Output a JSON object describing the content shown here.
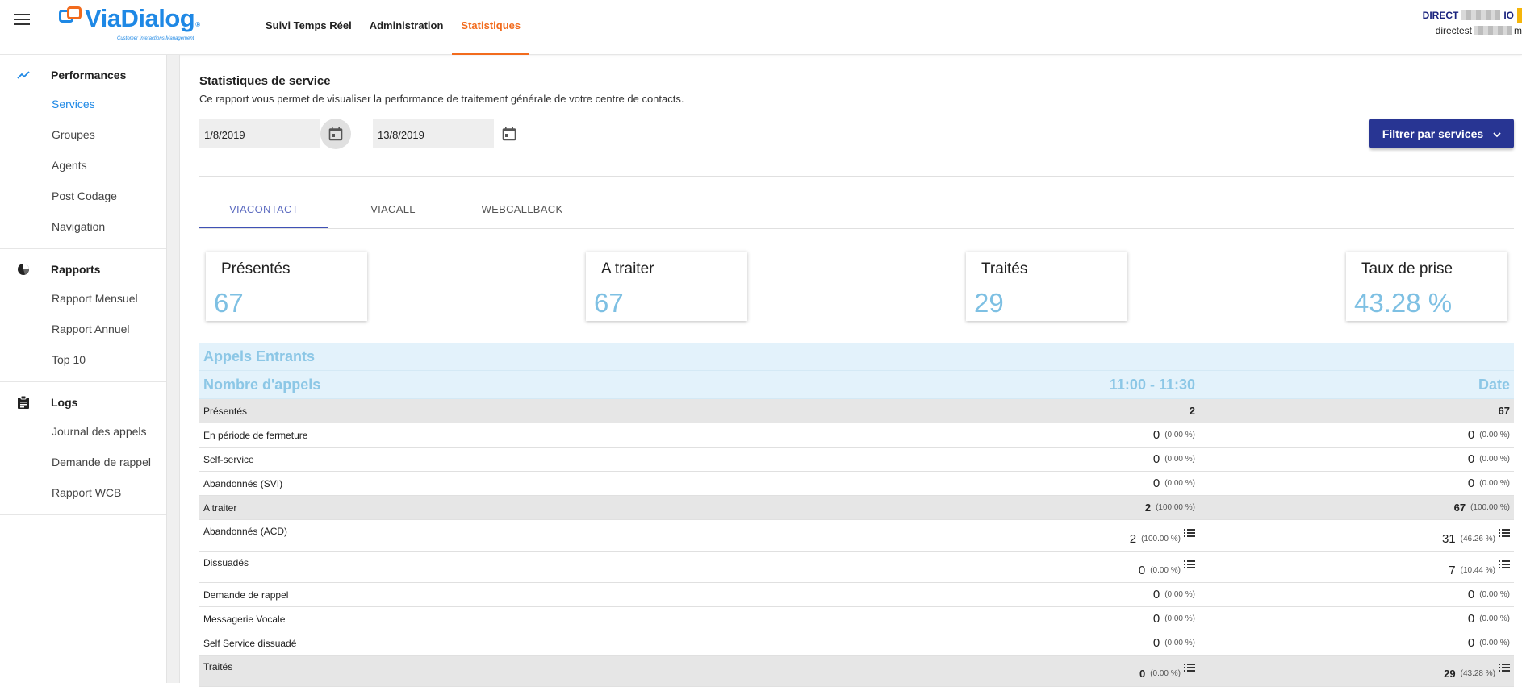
{
  "header": {
    "logo_text_via": "Via",
    "logo_text_dialog": "Dialog",
    "logo_tagline": "Customer Interactions Management",
    "logo_reg": "®",
    "nav": [
      {
        "label": "Suivi Temps Réel"
      },
      {
        "label": "Administration"
      },
      {
        "label": "Statistiques"
      }
    ],
    "user_line1": "DIRECT",
    "user_line1_suffix": "IO",
    "user_line2": "directest",
    "user_line2_suffix": "m"
  },
  "sidebar": {
    "sections": [
      {
        "label": "Performances",
        "icon": "trending-icon",
        "items": [
          "Services",
          "Groupes",
          "Agents",
          "Post Codage",
          "Navigation"
        ]
      },
      {
        "label": "Rapports",
        "icon": "pie-chart-icon",
        "items": [
          "Rapport Mensuel",
          "Rapport Annuel",
          "Top 10"
        ]
      },
      {
        "label": "Logs",
        "icon": "clipboard-icon",
        "items": [
          "Journal des appels",
          "Demande de rappel",
          "Rapport WCB"
        ]
      }
    ]
  },
  "page": {
    "title": "Statistiques de service",
    "description": "Ce rapport vous permet de visualiser la performance de traitement générale de votre centre de contacts.",
    "date_from": "1/8/2019",
    "date_to": "13/8/2019",
    "filter_label": "Filtrer par services"
  },
  "tabs": [
    {
      "label": "VIACONTACT"
    },
    {
      "label": "VIACALL"
    },
    {
      "label": "WEBCALLBACK"
    }
  ],
  "kpis": [
    {
      "label": "Présentés",
      "value": "67"
    },
    {
      "label": "A traiter",
      "value": "67"
    },
    {
      "label": "Traités",
      "value": "29"
    },
    {
      "label": "Taux de prise",
      "value": "43.28 %"
    }
  ],
  "stats": {
    "section_title": "Appels Entrants",
    "col_metric": "Nombre d'appels",
    "col_slot": "11:00 - 11:30",
    "col_date": "Date",
    "rows": [
      {
        "label": "Présentés",
        "slot": "2",
        "slot_pct": "",
        "date": "67",
        "date_pct": ""
      },
      {
        "label": "En période de fermeture",
        "slot": "0",
        "slot_pct": "(0.00 %)",
        "date": "0",
        "date_pct": "(0.00 %)"
      },
      {
        "label": "Self-service",
        "slot": "0",
        "slot_pct": "(0.00 %)",
        "date": "0",
        "date_pct": "(0.00 %)"
      },
      {
        "label": "Abandonnés (SVI)",
        "slot": "0",
        "slot_pct": "(0.00 %)",
        "date": "0",
        "date_pct": "(0.00 %)"
      },
      {
        "label": "A traiter",
        "slot": "2",
        "slot_pct": "(100.00 %)",
        "date": "67",
        "date_pct": "(100.00 %)"
      },
      {
        "label": "Abandonnés (ACD)",
        "slot": "2",
        "slot_pct": "(100.00 %)",
        "date": "31",
        "date_pct": "(46.26 %)"
      },
      {
        "label": "Dissuadés",
        "slot": "0",
        "slot_pct": "(0.00 %)",
        "date": "7",
        "date_pct": "(10.44 %)"
      },
      {
        "label": "Demande de rappel",
        "slot": "0",
        "slot_pct": "(0.00 %)",
        "date": "0",
        "date_pct": "(0.00 %)"
      },
      {
        "label": "Messagerie Vocale",
        "slot": "0",
        "slot_pct": "(0.00 %)",
        "date": "0",
        "date_pct": "(0.00 %)"
      },
      {
        "label": "Self Service dissuadé",
        "slot": "0",
        "slot_pct": "(0.00 %)",
        "date": "0",
        "date_pct": "(0.00 %)"
      },
      {
        "label": "Traités",
        "slot": "0",
        "slot_pct": "(0.00 %)",
        "date": "29",
        "date_pct": "(43.28 %)"
      }
    ]
  },
  "colors": {
    "accent_orange": "#f26b1d",
    "brand_blue": "#1e88e5",
    "filter_button": "#283593",
    "kpi_value": "#7ec0e3",
    "band_bg": "#e3f2fb"
  }
}
